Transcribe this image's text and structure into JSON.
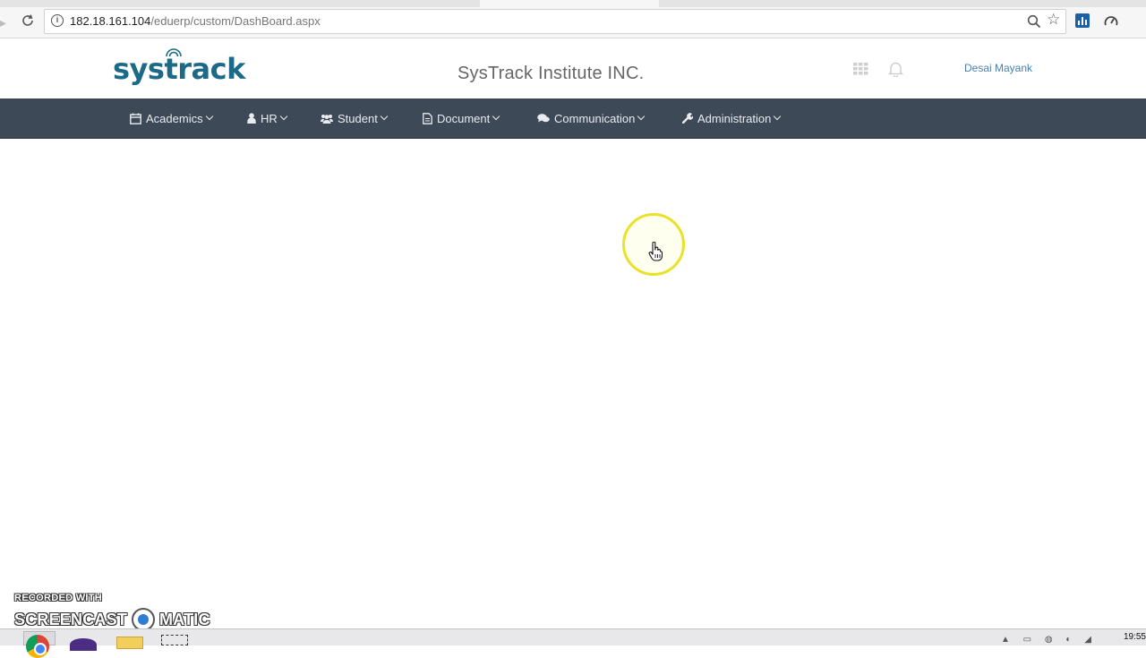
{
  "browser": {
    "url_host": "182.18.161.104",
    "url_path": "/eduerp/custom/DashBoard.aspx"
  },
  "header": {
    "logo_text": "systrack",
    "institute_name": "SysTrack Institute INC.",
    "user_name": "Desai Mayank"
  },
  "menu": {
    "items": [
      {
        "label": "Academics",
        "icon": "calendar-icon"
      },
      {
        "label": "HR",
        "icon": "user-icon"
      },
      {
        "label": "Student",
        "icon": "users-icon"
      },
      {
        "label": "Document",
        "icon": "file-icon"
      },
      {
        "label": "Communication",
        "icon": "comments-icon"
      },
      {
        "label": "Administration",
        "icon": "wrench-icon"
      }
    ]
  },
  "watermark": {
    "recorded": "RECORDED WITH",
    "brand_left": "SCREENCAST",
    "brand_right": "MATIC"
  },
  "taskbar": {
    "time": "19:55"
  },
  "colors": {
    "menu_bg": "#3e4957",
    "logo": "#1c6a87",
    "user_link": "#4a7fb0",
    "cursor_highlight": "#e9e12a"
  }
}
